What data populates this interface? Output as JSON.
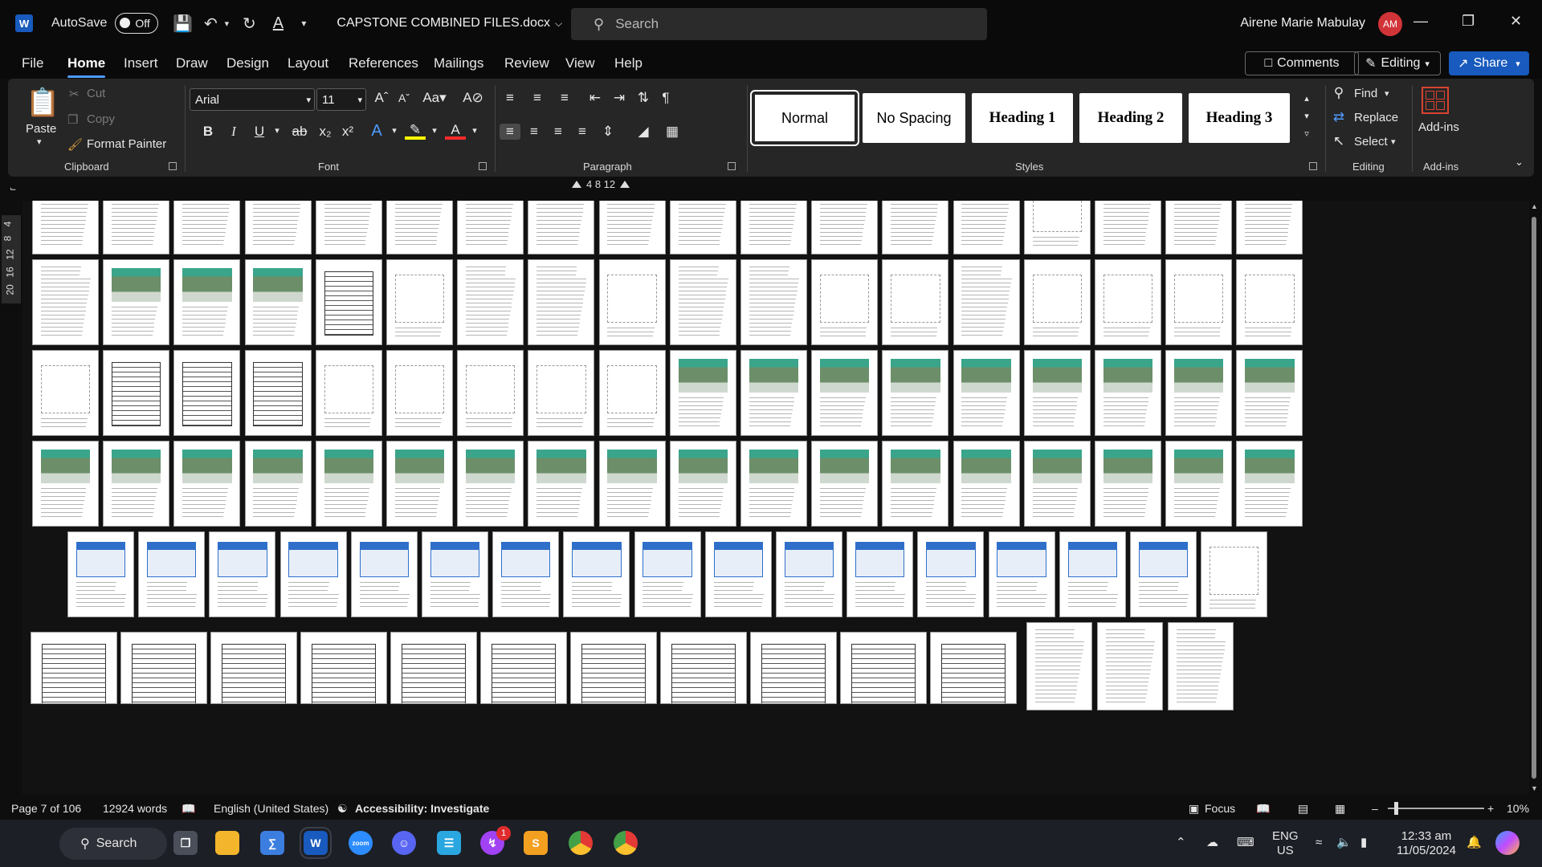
{
  "titlebar": {
    "autosave_label": "AutoSave",
    "autosave_state": "Off",
    "doc_title": "CAPSTONE COMBINED FILES.docx",
    "search_placeholder": "Search",
    "user_name": "Airene Marie Mabulay",
    "user_initials": "AM"
  },
  "menu": {
    "tabs": [
      "File",
      "Home",
      "Insert",
      "Draw",
      "Design",
      "Layout",
      "References",
      "Mailings",
      "Review",
      "View",
      "Help"
    ],
    "active": "Home",
    "comments": "Comments",
    "editing": "Editing",
    "share": "Share"
  },
  "ribbon": {
    "clipboard": {
      "paste": "Paste",
      "cut": "Cut",
      "copy": "Copy",
      "format_painter": "Format Painter",
      "label": "Clipboard"
    },
    "font": {
      "name": "Arial",
      "size": "11",
      "label": "Font"
    },
    "paragraph": {
      "label": "Paragraph"
    },
    "styles": {
      "items": [
        "Normal",
        "No Spacing",
        "Heading 1",
        "Heading 2",
        "Heading 3"
      ],
      "label": "Styles"
    },
    "editing": {
      "find": "Find",
      "replace": "Replace",
      "select": "Select",
      "label": "Editing"
    },
    "addins": {
      "button": "Add-ins",
      "label": "Add-ins"
    }
  },
  "ruler": {
    "marks": "4   8   12",
    "vertical": [
      "4",
      "8",
      "12",
      "16",
      "20"
    ]
  },
  "status": {
    "page": "Page 7 of 106",
    "words": "12924 words",
    "language": "English (United States)",
    "accessibility": "Accessibility: Investigate",
    "focus": "Focus",
    "zoom": "10%"
  },
  "taskbar": {
    "search": "Search",
    "lang_top": "ENG",
    "lang_bottom": "US",
    "time": "12:33 am",
    "date": "11/05/2024",
    "messenger_badge": "1",
    "colors": {
      "taskbar": "#1c1f26",
      "accent": "#185abd"
    }
  }
}
